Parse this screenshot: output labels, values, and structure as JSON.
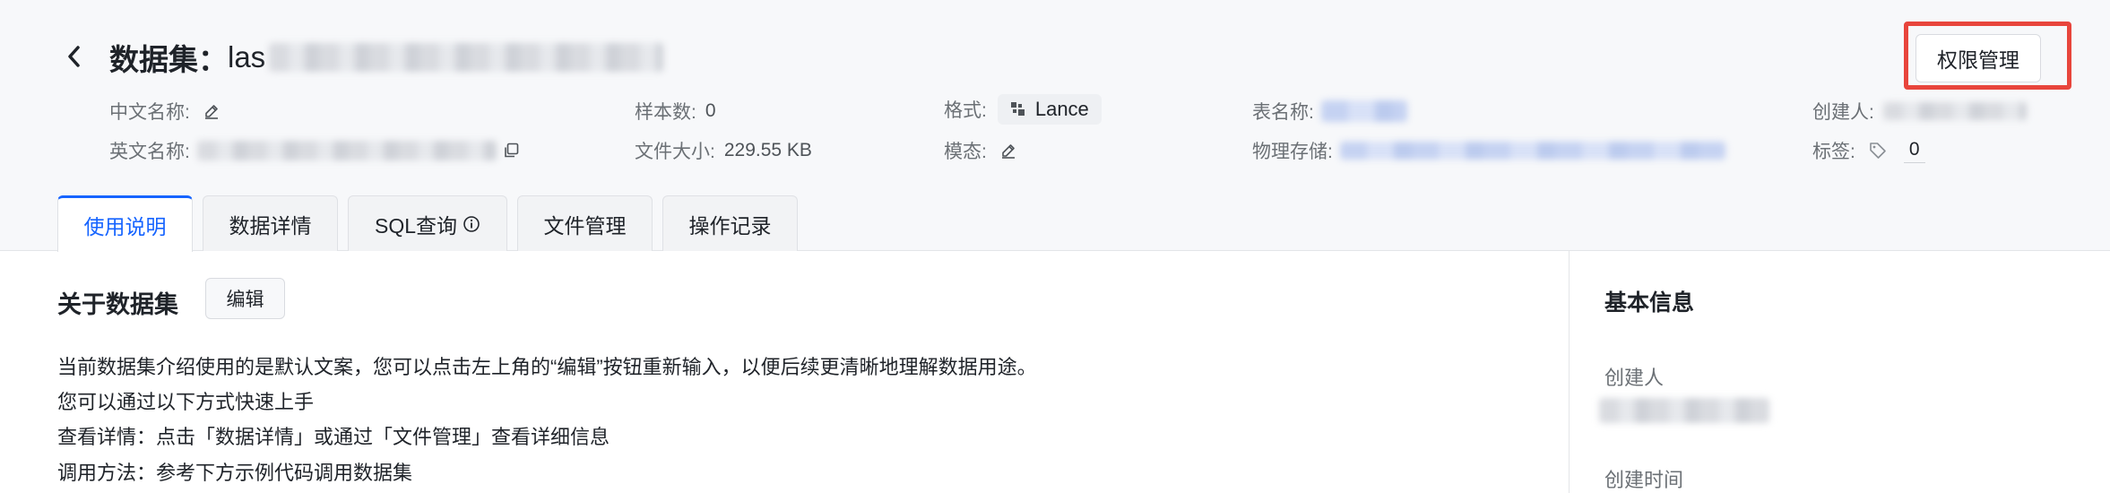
{
  "header": {
    "title_prefix": "数据集：",
    "title_name": "las",
    "permission_button": "权限管理"
  },
  "meta": {
    "cn_name_label": "中文名称:",
    "en_name_label": "英文名称:",
    "samples_label": "样本数:",
    "samples_value": "0",
    "filesize_label": "文件大小:",
    "filesize_value": "229.55 KB",
    "format_label": "格式:",
    "format_value": "Lance",
    "modality_label": "模态:",
    "table_label": "表名称:",
    "storage_label": "物理存储:",
    "creator_label": "创建人:",
    "tags_label": "标签:",
    "tags_count": "0"
  },
  "tabs": [
    {
      "label": "使用说明",
      "active": true
    },
    {
      "label": "数据详情",
      "active": false
    },
    {
      "label": "SQL查询",
      "active": false
    },
    {
      "label": "文件管理",
      "active": false
    },
    {
      "label": "操作记录",
      "active": false
    }
  ],
  "about": {
    "title": "关于数据集",
    "edit_button": "编辑",
    "lines": [
      "当前数据集介绍使用的是默认文案，您可以点击左上角的“编辑”按钮重新输入，以便后续更清晰地理解数据用途。",
      "您可以通过以下方式快速上手",
      "查看详情：点击「数据详情」或通过「文件管理」查看详细信息",
      "调用方法：参考下方示例代码调用数据集"
    ]
  },
  "basic_info": {
    "title": "基本信息",
    "creator_label": "创建人",
    "created_time_label": "创建时间"
  },
  "colors": {
    "accent": "#1664ff",
    "highlight_border": "#e8453c",
    "header_bg": "#f7f8fa"
  }
}
